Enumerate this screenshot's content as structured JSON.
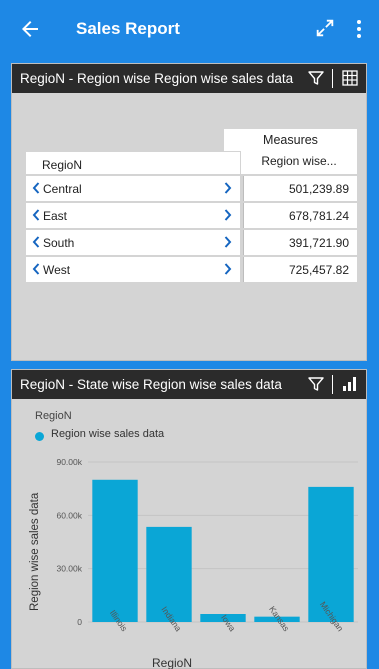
{
  "app": {
    "title": "Sales Report"
  },
  "colors": {
    "appbar": "#1e88e5",
    "header": "#2b2b2b",
    "accent": "#0aa6d6",
    "chevron": "#1565c0"
  },
  "table_card": {
    "title": "RegioN - Region wise Region wise sales data",
    "measures_label": "Measures",
    "row_header": "RegioN",
    "value_header": "Region wise...",
    "rows": [
      {
        "label": "Central",
        "value": "501,239.89"
      },
      {
        "label": "East",
        "value": "678,781.24"
      },
      {
        "label": "South",
        "value": "391,721.90"
      },
      {
        "label": "West",
        "value": "725,457.82"
      }
    ]
  },
  "chart_card": {
    "title": "RegioN - State wise Region wise sales data",
    "legend_title": "RegioN"
  },
  "chart_data": {
    "type": "bar",
    "categories": [
      "Illinois",
      "Indiana",
      "Iowa",
      "Kansas",
      "Michigan"
    ],
    "series": [
      {
        "name": "Region wise sales data",
        "values": [
          80000,
          53500,
          4500,
          3000,
          76000
        ]
      }
    ],
    "ylabel": "Region wise sales data",
    "xlabel": "RegioN",
    "ylim": [
      0,
      90000
    ],
    "yticks": [
      {
        "value": 0,
        "label": "0"
      },
      {
        "value": 30000,
        "label": "30.00k"
      },
      {
        "value": 60000,
        "label": "60.00k"
      },
      {
        "value": 90000,
        "label": "90.00k"
      }
    ],
    "legend": "top-left",
    "grid": true
  }
}
